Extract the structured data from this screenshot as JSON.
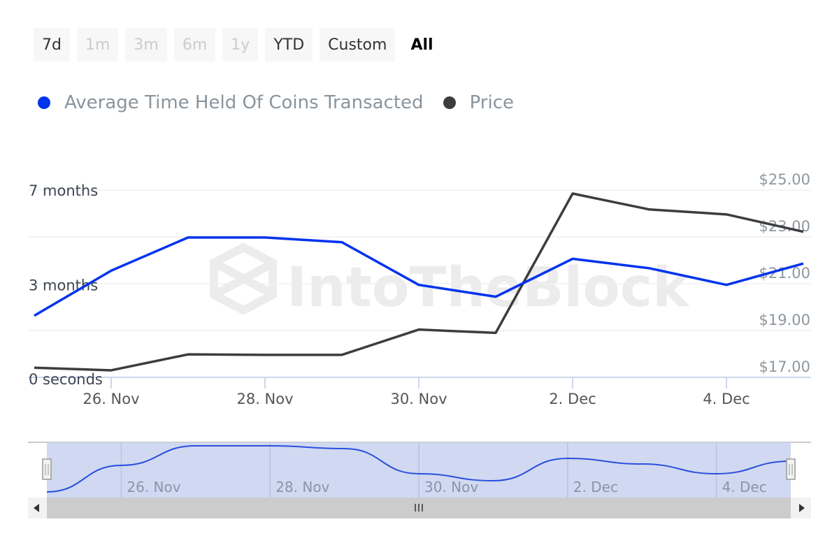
{
  "range_selector": {
    "buttons": [
      {
        "label": "7d",
        "state": "normal"
      },
      {
        "label": "1m",
        "state": "disabled"
      },
      {
        "label": "3m",
        "state": "disabled"
      },
      {
        "label": "6m",
        "state": "disabled"
      },
      {
        "label": "1y",
        "state": "disabled"
      },
      {
        "label": "YTD",
        "state": "normal"
      },
      {
        "label": "Custom",
        "state": "normal"
      },
      {
        "label": "All",
        "state": "active"
      }
    ]
  },
  "watermark": "IntoTheBlock",
  "colors": {
    "avg_time_held": "#0033ee",
    "price": "#3d3d3f",
    "navigator_fill": "#c8d2ef",
    "navigator_line": "#2a4fdc"
  },
  "chart_data": {
    "type": "line",
    "title": "",
    "legend_position": "top-left",
    "x": [
      "25 Nov",
      "26 Nov",
      "27 Nov",
      "28 Nov",
      "29 Nov",
      "30 Nov",
      "1 Dec",
      "2 Dec",
      "3 Dec",
      "4 Dec",
      "5 Dec"
    ],
    "x_tick_labels": [
      "26. Nov",
      "28. Nov",
      "30. Nov",
      "2. Dec",
      "4. Dec"
    ],
    "x_tick_indices": [
      1,
      3,
      5,
      7,
      9
    ],
    "series": [
      {
        "name": "Average Time Held Of Coins Transacted",
        "axis": "left",
        "unit": "months",
        "values": [
          2.6,
          4.5,
          5.9,
          5.9,
          5.7,
          3.9,
          3.4,
          5.0,
          4.6,
          3.9,
          4.8
        ]
      },
      {
        "name": "Price",
        "axis": "right",
        "unit": "USD",
        "values": [
          17.41,
          17.3,
          17.98,
          17.96,
          17.96,
          19.04,
          18.9,
          24.85,
          24.17,
          23.96,
          23.22
        ]
      }
    ],
    "y_left": {
      "label": "",
      "range": [
        0,
        7.9
      ],
      "tick_labels": [
        {
          "value": 0,
          "label": "0 seconds"
        },
        {
          "value": 3.9,
          "label": "3 months"
        },
        {
          "value": 7.9,
          "label": "7 months"
        }
      ]
    },
    "y_right": {
      "label": "",
      "range": [
        17,
        25
      ],
      "ticks": [
        17,
        19,
        21,
        23,
        25
      ],
      "tick_labels": [
        "$17.00",
        "$19.00",
        "$21.00",
        "$23.00",
        "$25.00"
      ]
    },
    "grid": true,
    "navigator": {
      "x_tick_labels": [
        "26. Nov",
        "28. Nov",
        "30. Nov",
        "2. Dec",
        "4. Dec"
      ],
      "selected_range": [
        "25 Nov",
        "5 Dec"
      ]
    }
  }
}
